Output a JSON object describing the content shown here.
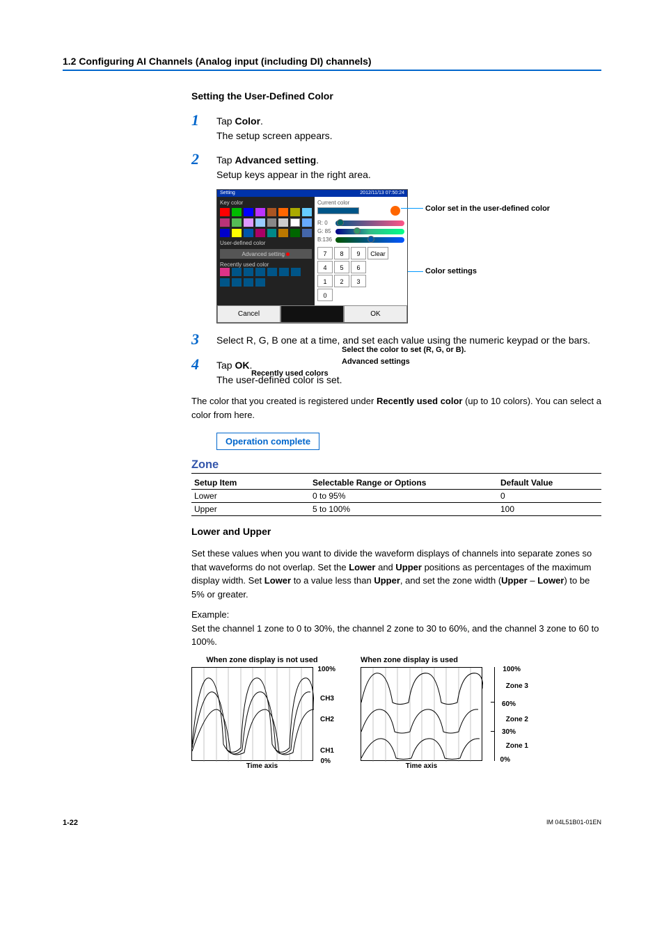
{
  "section_header": "1.2  Configuring AI Channels (Analog input (including DI) channels)",
  "title": "Setting the User-Defined Color",
  "steps": {
    "s1a": "Tap ",
    "s1b": "Color",
    "s1c": ".",
    "s1d": "The setup screen appears.",
    "s2a": "Tap ",
    "s2b": "Advanced setting",
    "s2c": ".",
    "s2d": "Setup keys appear in the right area.",
    "s3": "Select R, G, B one at a time, and set each value using the numeric keypad or the bars.",
    "s4a": "Tap ",
    "s4b": "OK",
    "s4c": ".",
    "s4d": "The user-defined color is set."
  },
  "note1a": "The color that you created is registered under ",
  "note1b": "Recently used color",
  "note1c": " (up to 10 colors). You can select a color from here.",
  "op_complete": "Operation complete",
  "callouts": {
    "c1": "Color set in the user-defined color",
    "c2": "Color settings",
    "c3": "Select the color to set (R, G, or B).",
    "c4": "Advanced settings",
    "c5": "Recently used colors"
  },
  "device": {
    "key_color": "Key color",
    "user_defined": "User-defined color",
    "adv_setting": "Advanced setting",
    "recently_used": "Recently used color",
    "cancel": "Cancel",
    "ok": "OK",
    "current_color": "Current color",
    "R": "R:   0",
    "G": "G:  85",
    "B": "B:136",
    "keys": [
      "7",
      "8",
      "9",
      "Clear",
      "4",
      "5",
      "6",
      "1",
      "2",
      "3",
      "0"
    ]
  },
  "zone": {
    "heading": "Zone",
    "th1": "Setup Item",
    "th2": "Selectable Range or Options",
    "th3": "Default Value",
    "r1c1": "Lower",
    "r1c2": "0 to 95%",
    "r1c3": "0",
    "r2c1": "Upper",
    "r2c2": "5 to 100%",
    "r2c3": "100",
    "sub": "Lower and Upper",
    "p1a": "Set these values when you want to divide the waveform displays of channels into separate zones so that waveforms do not overlap. Set the ",
    "p1b": "Lower",
    "p1c": " and ",
    "p1d": "Upper",
    "p1e": " positions as percentages of the maximum display width. Set ",
    "p1f": "Lower",
    "p1g": " to a value less than ",
    "p1h": "Upper",
    "p1i": ", and set the zone width (",
    "p1j": "Upper",
    "p1k": " – ",
    "p1l": "Lower",
    "p1m": ") to be 5% or greater.",
    "example": "Example:",
    "ex_text": "Set the channel 1 zone to 0 to 30%, the channel 2 zone to 30 to 60%, and the channel 3 zone to 60 to 100%.",
    "g1_title": "When zone display is not used",
    "g2_title": "When zone display is used",
    "time_axis": "Time axis",
    "p100": "100%",
    "p60": "60%",
    "p30": "30%",
    "p0": "0%",
    "ch1": "CH1",
    "ch2": "CH2",
    "ch3": "CH3",
    "z1": "Zone 1",
    "z2": "Zone 2",
    "z3": "Zone 3"
  },
  "footer": {
    "page": "1-22",
    "doc": "IM 04L51B01-01EN"
  }
}
